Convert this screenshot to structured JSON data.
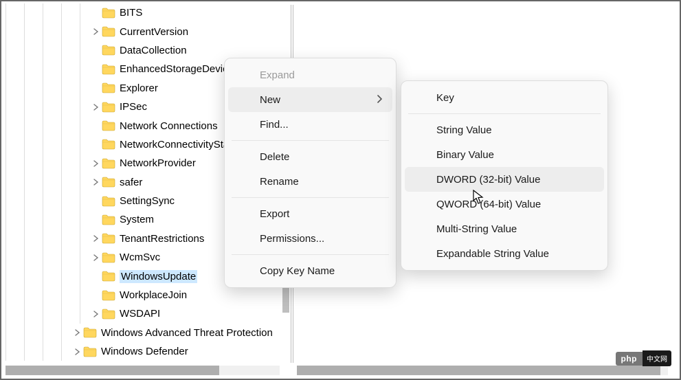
{
  "tree": [
    {
      "depth": 5,
      "expander": "none",
      "label": "BITS"
    },
    {
      "depth": 5,
      "expander": "collapsed",
      "label": "CurrentVersion"
    },
    {
      "depth": 5,
      "expander": "none",
      "label": "DataCollection"
    },
    {
      "depth": 5,
      "expander": "none",
      "label": "EnhancedStorageDevices"
    },
    {
      "depth": 5,
      "expander": "none",
      "label": "Explorer"
    },
    {
      "depth": 5,
      "expander": "collapsed",
      "label": "IPSec"
    },
    {
      "depth": 5,
      "expander": "none",
      "label": "Network Connections"
    },
    {
      "depth": 5,
      "expander": "none",
      "label": "NetworkConnectivityStatusIndicator"
    },
    {
      "depth": 5,
      "expander": "collapsed",
      "label": "NetworkProvider"
    },
    {
      "depth": 5,
      "expander": "collapsed",
      "label": "safer"
    },
    {
      "depth": 5,
      "expander": "none",
      "label": "SettingSync"
    },
    {
      "depth": 5,
      "expander": "none",
      "label": "System"
    },
    {
      "depth": 5,
      "expander": "collapsed",
      "label": "TenantRestrictions"
    },
    {
      "depth": 5,
      "expander": "collapsed",
      "label": "WcmSvc"
    },
    {
      "depth": 5,
      "expander": "none",
      "label": "WindowsUpdate",
      "selected": true
    },
    {
      "depth": 5,
      "expander": "none",
      "label": "WorkplaceJoin"
    },
    {
      "depth": 5,
      "expander": "collapsed",
      "label": "WSDAPI"
    },
    {
      "depth": 4,
      "expander": "collapsed",
      "label": "Windows Advanced Threat Protection"
    },
    {
      "depth": 4,
      "expander": "collapsed",
      "label": "Windows Defender"
    }
  ],
  "menu1": {
    "expand": "Expand",
    "new": "New",
    "find": "Find...",
    "delete": "Delete",
    "rename": "Rename",
    "export": "Export",
    "permissions": "Permissions...",
    "copy_key_name": "Copy Key Name"
  },
  "menu2": {
    "key": "Key",
    "string": "String Value",
    "binary": "Binary Value",
    "dword": "DWORD (32-bit) Value",
    "qword": "QWORD (64-bit) Value",
    "multi": "Multi-String Value",
    "expand_str": "Expandable String Value"
  },
  "badge": {
    "php": "php",
    "cn": "中文网"
  }
}
